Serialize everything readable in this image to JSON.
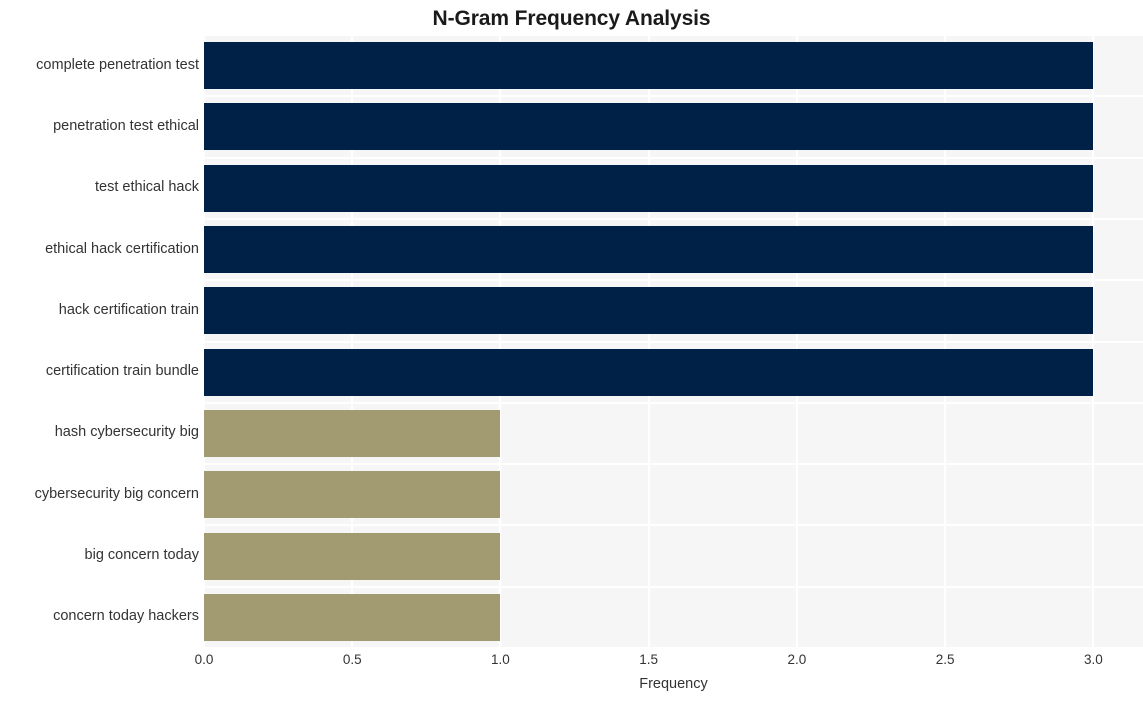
{
  "chart_data": {
    "type": "bar",
    "orientation": "horizontal",
    "title": "N-Gram Frequency Analysis",
    "xlabel": "Frequency",
    "ylabel": "",
    "xlim": [
      0.0,
      3.1675
    ],
    "xticks": [
      0.0,
      0.5,
      1.0,
      1.5,
      2.0,
      2.5,
      3.0
    ],
    "xticklabels": [
      "0.0",
      "0.5",
      "1.0",
      "1.5",
      "2.0",
      "2.5",
      "3.0"
    ],
    "grid": true,
    "legend": false,
    "categories": [
      "complete penetration test",
      "penetration test ethical",
      "test ethical hack",
      "ethical hack certification",
      "hack certification train",
      "certification train bundle",
      "hash cybersecurity big",
      "cybersecurity big concern",
      "big concern today",
      "concern today hackers"
    ],
    "values": [
      3,
      3,
      3,
      3,
      3,
      3,
      1,
      1,
      1,
      1
    ],
    "bar_colors": [
      "#002147",
      "#002147",
      "#002147",
      "#002147",
      "#002147",
      "#002147",
      "#a29b72",
      "#a29b72",
      "#a29b72",
      "#a29b72"
    ],
    "palette": {
      "high_frequency": "#002147",
      "low_frequency": "#a29b72",
      "plot_background": "#f6f6f7",
      "gridline": "#ffffff",
      "figure_background": "#ffffff",
      "text": "#333333",
      "title_text": "#1a1a1a"
    }
  }
}
